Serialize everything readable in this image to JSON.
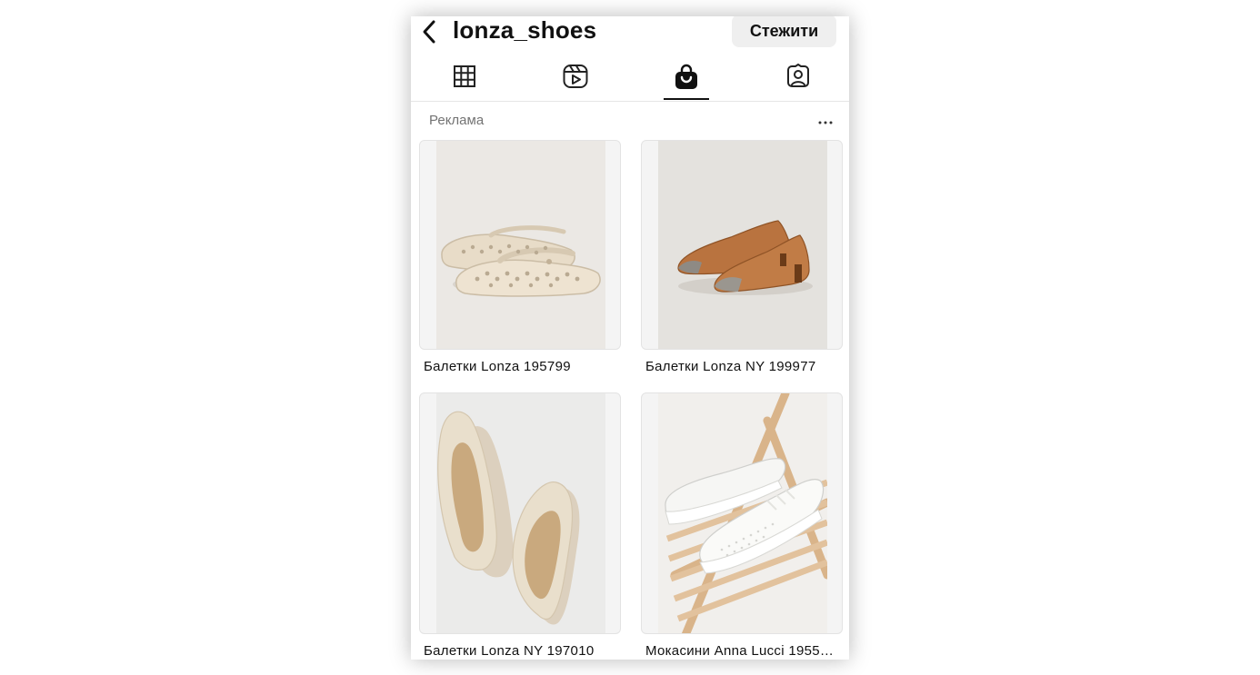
{
  "header": {
    "username": "lonza_shoes",
    "follow_label": "Стежити",
    "back_icon": "chevron-left-icon"
  },
  "tabs": [
    {
      "icon": "grid-icon",
      "active": false
    },
    {
      "icon": "reels-icon",
      "active": false
    },
    {
      "icon": "shopping-bag-icon",
      "active": true
    },
    {
      "icon": "tagged-icon",
      "active": false
    }
  ],
  "section": {
    "ad_label": "Реклама",
    "more_icon": "more-horizontal-icon"
  },
  "products": [
    {
      "title": "Балетки Lonza 195799"
    },
    {
      "title": "Балетки Lonza NY 199977"
    },
    {
      "title": "Балетки Lonza NY 197010"
    },
    {
      "title": "Мокасини Anna Lucci 1955…"
    }
  ],
  "colors": {
    "text": "#111111",
    "secondary_text": "#737373",
    "button_bg": "#efefef"
  }
}
